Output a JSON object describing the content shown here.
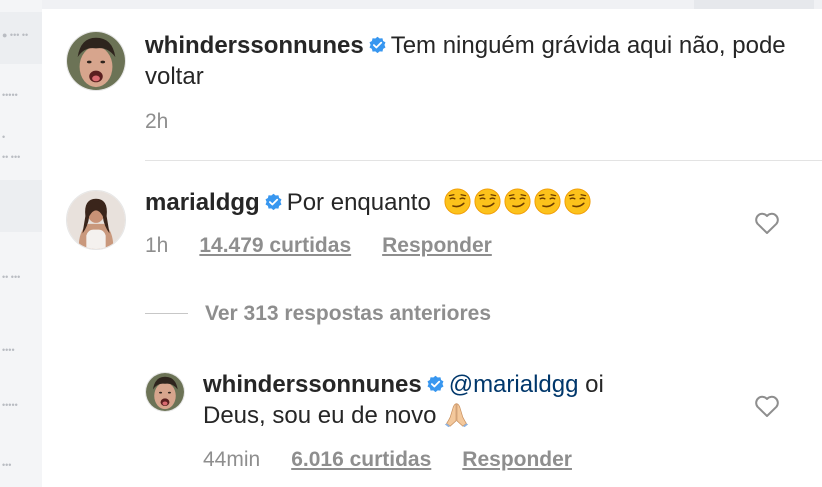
{
  "comments": [
    {
      "username": "whinderssonnunes",
      "text": "Tem ninguém grávida aqui não, pode voltar",
      "time": "2h"
    },
    {
      "username": "marialdgg",
      "text": "Por enquanto",
      "emojis": [
        "smirk-emoji",
        "smirk-emoji",
        "smirk-emoji",
        "smirk-emoji",
        "smirk-emoji"
      ],
      "time": "1h",
      "likes": "14.479 curtidas",
      "reply_label": "Responder"
    }
  ],
  "view_replies": "Ver 313 respostas anteriores",
  "reply": {
    "username": "whinderssonnunes",
    "mention": "@marialdgg",
    "text_after_mention": " oi",
    "text_line2": "Deus, sou eu de novo",
    "emoji": "folded-hands-emoji",
    "time": "44min",
    "likes": "6.016 curtidas",
    "reply_label": "Responder"
  },
  "colors": {
    "verified": "#3897f0",
    "meta_gray": "#8e8e8e",
    "mention_blue": "#00376b",
    "text": "#262626"
  }
}
